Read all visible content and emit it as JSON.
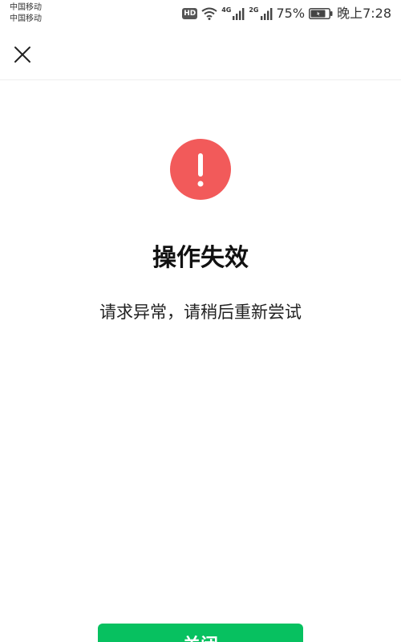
{
  "status_bar": {
    "carrier_1": "中国移动",
    "carrier_2": "中国移动",
    "hd_badge": "HD",
    "network_1": "4G",
    "network_2": "2G",
    "battery_percent": "75%",
    "time": "晚上7:28",
    "icons": [
      "wifi-icon",
      "signal-icon",
      "battery-icon"
    ]
  },
  "nav": {
    "close_icon": "close-icon"
  },
  "result": {
    "status_icon": "exclamation-icon",
    "status_color": "#f25a5a",
    "title": "操作失效",
    "message": "请求异常，请稍后重新尝试"
  },
  "actions": {
    "close_label": "关闭",
    "button_color": "#07c160"
  }
}
